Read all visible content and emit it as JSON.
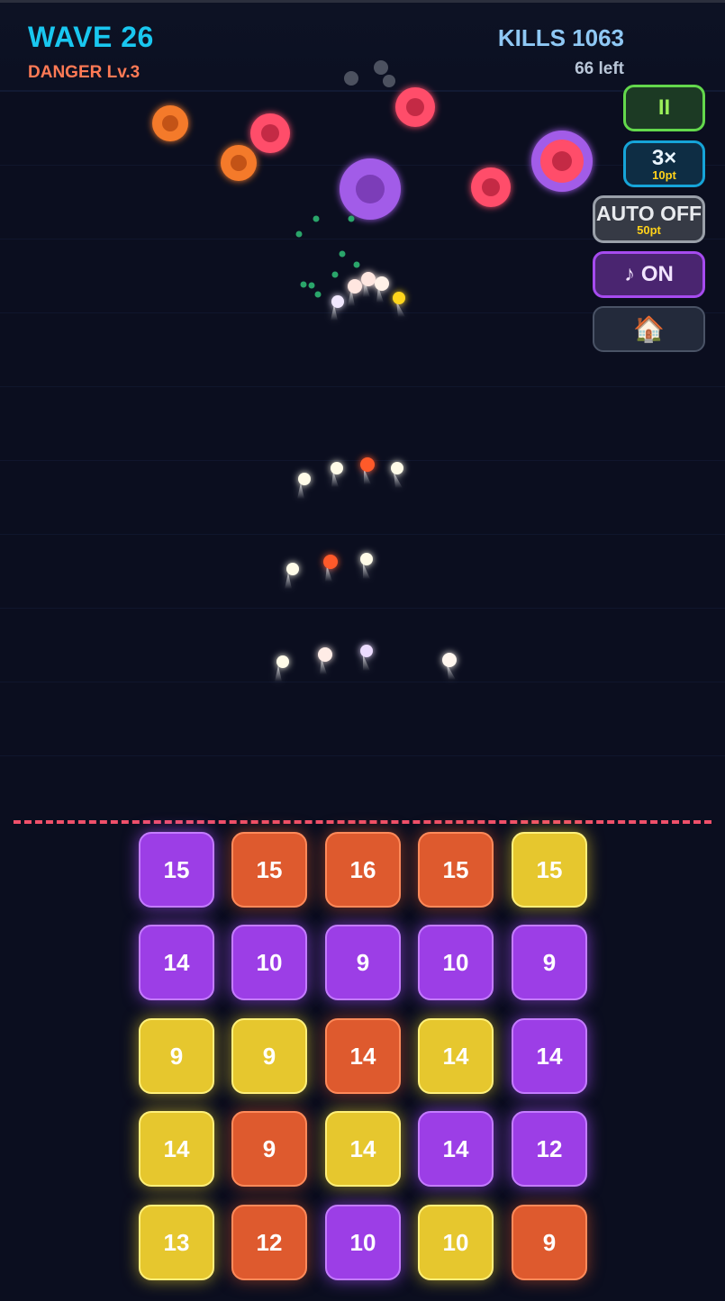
{
  "hud": {
    "wave": "WAVE 26",
    "danger": "DANGER Lv.3",
    "kills": "KILLS 1063",
    "remaining": "66 left"
  },
  "controls": {
    "pause_label": "II",
    "speed_label": "3×",
    "speed_cost": "10pt",
    "auto_label": "AUTO OFF",
    "auto_cost": "50pt",
    "music_label": "♪ ON",
    "home_icon": "🏠"
  },
  "colors": {
    "accent": "#19c7f0",
    "danger": "#ff7a55",
    "tile_purple": "#9c3ee6",
    "tile_orange": "#de5a2e",
    "tile_yellow": "#e6c72e",
    "danger_line": "#f0506a"
  },
  "tiles": [
    [
      {
        "value": "15",
        "color": "purple"
      },
      {
        "value": "15",
        "color": "orange"
      },
      {
        "value": "16",
        "color": "orange"
      },
      {
        "value": "15",
        "color": "orange"
      },
      {
        "value": "15",
        "color": "yellow"
      }
    ],
    [
      {
        "value": "14",
        "color": "purple"
      },
      {
        "value": "10",
        "color": "purple"
      },
      {
        "value": "9",
        "color": "purple"
      },
      {
        "value": "10",
        "color": "purple"
      },
      {
        "value": "9",
        "color": "purple"
      }
    ],
    [
      {
        "value": "9",
        "color": "yellow"
      },
      {
        "value": "9",
        "color": "yellow"
      },
      {
        "value": "14",
        "color": "orange"
      },
      {
        "value": "14",
        "color": "yellow"
      },
      {
        "value": "14",
        "color": "purple"
      }
    ],
    [
      {
        "value": "14",
        "color": "yellow"
      },
      {
        "value": "9",
        "color": "orange"
      },
      {
        "value": "14",
        "color": "yellow"
      },
      {
        "value": "14",
        "color": "purple"
      },
      {
        "value": "12",
        "color": "purple"
      }
    ],
    [
      {
        "value": "13",
        "color": "yellow"
      },
      {
        "value": "12",
        "color": "orange"
      },
      {
        "value": "10",
        "color": "purple"
      },
      {
        "value": "10",
        "color": "yellow"
      },
      {
        "value": "9",
        "color": "orange"
      }
    ]
  ]
}
